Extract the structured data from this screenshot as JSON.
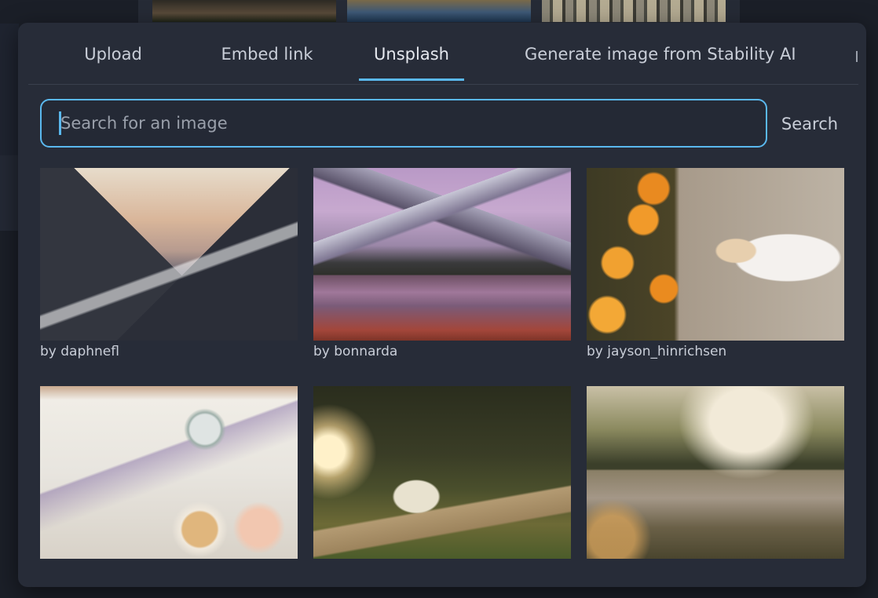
{
  "tabs": [
    {
      "label": "Upload",
      "active": false
    },
    {
      "label": "Embed link",
      "active": false
    },
    {
      "label": "Unsplash",
      "active": true
    },
    {
      "label": "Generate image from Stability AI",
      "active": false
    }
  ],
  "search": {
    "placeholder": "Search for an image",
    "value": "",
    "button_label": "Search"
  },
  "results": [
    {
      "credit": "by daphnefl"
    },
    {
      "credit": "by bonnarda"
    },
    {
      "credit": "by jayson_hinrichsen"
    },
    {
      "credit": ""
    },
    {
      "credit": ""
    },
    {
      "credit": ""
    }
  ],
  "colors": {
    "accent": "#5ab8ee",
    "modal_bg": "#272c38",
    "text": "#c9ced8"
  }
}
